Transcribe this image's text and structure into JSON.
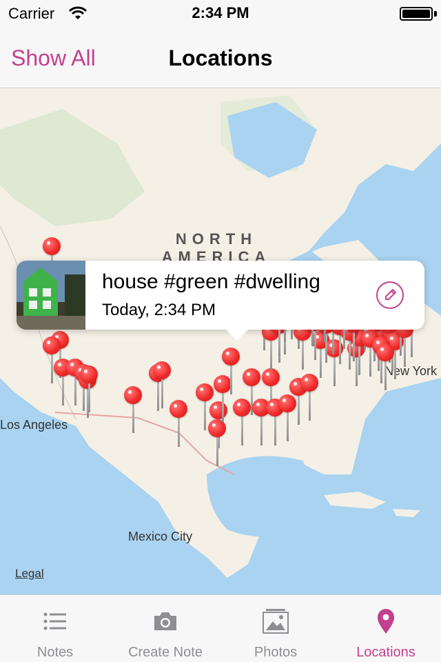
{
  "status": {
    "carrier": "Carrier",
    "time": "2:34 PM",
    "icons": [
      "wifi-icon",
      "battery-icon"
    ]
  },
  "nav": {
    "left_button": "Show All",
    "title": "Locations"
  },
  "map": {
    "labels": {
      "continent": "NORTH AMERICA",
      "los_angeles": "Los Angeles",
      "new_york": "New York",
      "mexico_city": "Mexico City"
    },
    "legal": "Legal",
    "pin_count": 60,
    "callout": {
      "title": "house #green #dwelling",
      "subtitle": "Today, 2:34 PM",
      "edit_icon": "pencil-icon"
    }
  },
  "tabs": [
    {
      "label": "Notes",
      "icon": "list-icon",
      "active": false
    },
    {
      "label": "Create Note",
      "icon": "camera-icon",
      "active": false
    },
    {
      "label": "Photos",
      "icon": "photo-icon",
      "active": false
    },
    {
      "label": "Locations",
      "icon": "location-pin-icon",
      "active": true
    }
  ],
  "colors": {
    "accent": "#c2408f",
    "pin": "#f22b2b",
    "water": "#a9d3f0",
    "land": "#f4f0e6"
  }
}
